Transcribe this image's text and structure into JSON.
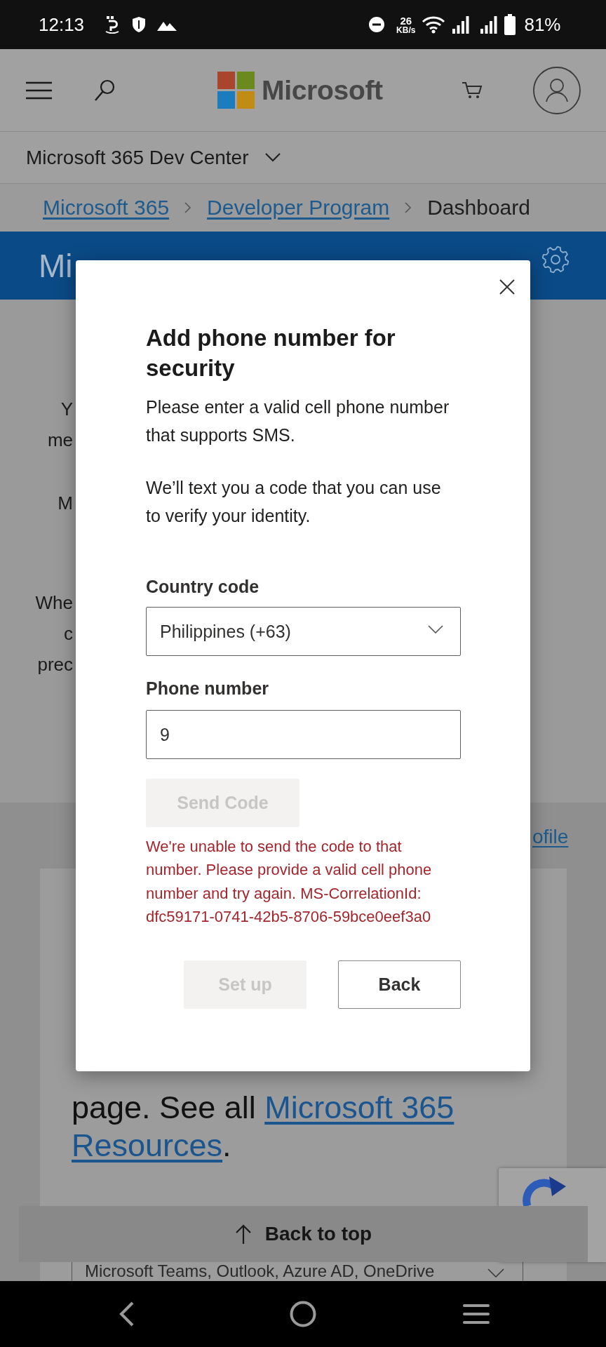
{
  "status_bar": {
    "time": "12:13",
    "net_speed": "26",
    "net_speed_unit": "KB/s",
    "battery": "81%"
  },
  "header": {
    "logo_text": "Microsoft"
  },
  "site_nav": {
    "title": "Microsoft 365 Dev Center",
    "expanded": false
  },
  "breadcrumb": [
    {
      "label": "Microsoft 365",
      "kind": "link"
    },
    {
      "label": "Developer Program",
      "kind": "link"
    },
    {
      "label": "Dashboard",
      "kind": "current"
    }
  ],
  "banner": {
    "title": "Mi"
  },
  "intro_fragments": [
    {
      "lines": [
        "Y",
        "me"
      ]
    },
    {
      "lines": [
        "M"
      ]
    },
    {
      "lines": [
        "Whe",
        "c",
        "prec"
      ]
    }
  ],
  "profile_link": "ofile",
  "card": {
    "paragraph": [
      {
        "text": "page. See all ",
        "kind": "plain"
      },
      {
        "text": "Microsoft 365",
        "kind": "link"
      },
      {
        "text": "Resources",
        "kind": "link"
      },
      {
        "text": ".",
        "kind": "plain"
      }
    ],
    "dropdown_value": "Microsoft Teams, Outlook, Azure AD, OneDrive"
  },
  "back_to_top": {
    "label": "Back to top"
  },
  "dialog": {
    "title": "Add phone number for security",
    "paragraphs": [
      "Please enter a valid cell phone number that supports SMS.",
      "We’ll text you a code that you can use to verify your identity."
    ],
    "fields": [
      {
        "label": "Country code",
        "kind": "select",
        "value": "Philippines (+63)"
      },
      {
        "label": "Phone number",
        "kind": "text",
        "value": "9"
      }
    ],
    "send_button": {
      "label": "Send Code",
      "disabled": true
    },
    "error": "We're unable to send the code to that number. Please provide a valid cell phone number and try again. MS-CorrelationId: dfc59171-0741-42b5-8706-59bce0eef3a0",
    "buttons": [
      {
        "label": "Set up",
        "disabled": true
      },
      {
        "label": "Back",
        "disabled": false
      }
    ]
  }
}
